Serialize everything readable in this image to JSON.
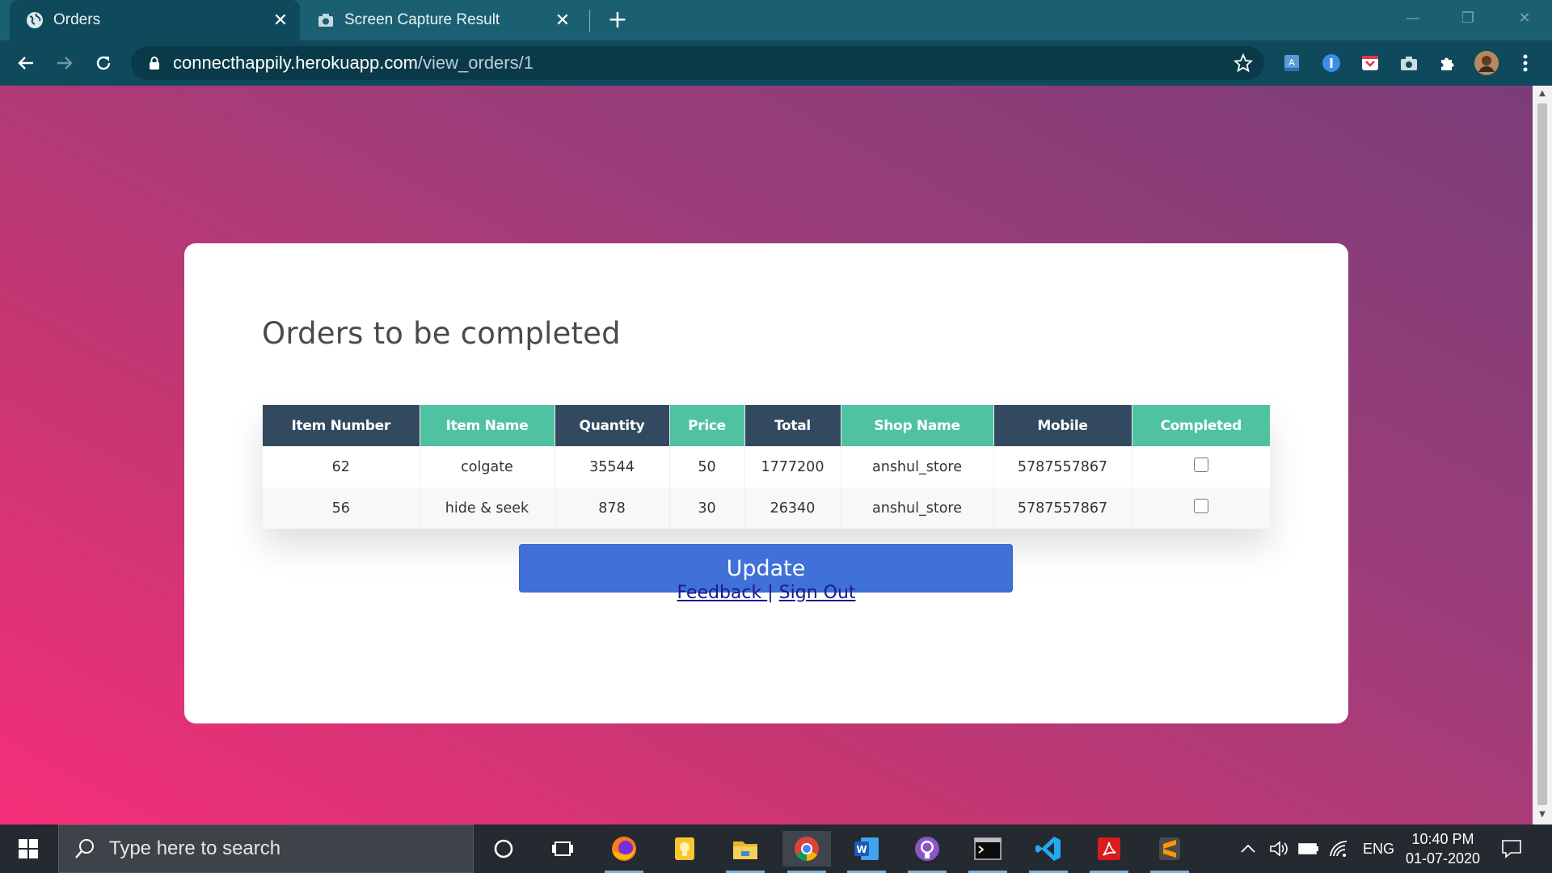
{
  "browser": {
    "tabs": [
      {
        "title": "Orders",
        "active": true,
        "icon": "globe-icon"
      },
      {
        "title": "Screen Capture Result",
        "active": false,
        "icon": "camera-icon"
      }
    ],
    "url_host": "connecthappily.herokuapp.com",
    "url_path": "/view_orders/1"
  },
  "page": {
    "heading": "Orders to be completed",
    "table": {
      "headers": [
        "Item Number",
        "Item Name",
        "Quantity",
        "Price",
        "Total",
        "Shop Name",
        "Mobile",
        "Completed"
      ],
      "rows": [
        {
          "item_number": "62",
          "item_name": "colgate",
          "quantity": "35544",
          "price": "50",
          "total": "1777200",
          "shop_name": "anshul_store",
          "mobile": "5787557867",
          "completed": false
        },
        {
          "item_number": "56",
          "item_name": "hide & seek",
          "quantity": "878",
          "price": "30",
          "total": "26340",
          "shop_name": "anshul_store",
          "mobile": "5787557867",
          "completed": false
        }
      ]
    },
    "update_label": "Update",
    "links": {
      "feedback": "Feedback ",
      "separator": "|",
      "signout": "Sign Out"
    }
  },
  "taskbar": {
    "search_placeholder": "Type here to search",
    "language": "ENG",
    "time": "10:40 PM",
    "date": "01-07-2020"
  },
  "colors": {
    "header_dark": "#324960",
    "header_teal": "#4fc3a1",
    "button": "#4070d9",
    "gradient_start": "#f52f79",
    "gradient_end": "#7a3d78"
  }
}
